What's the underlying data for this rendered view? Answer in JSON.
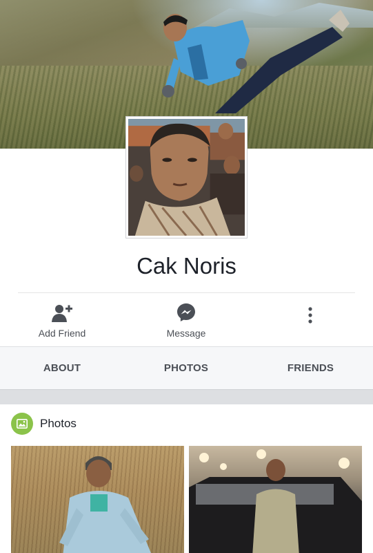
{
  "profile": {
    "name": "Cak Noris"
  },
  "actions": [
    {
      "label": "Add Friend",
      "icon": "add-friend-icon"
    },
    {
      "label": "Message",
      "icon": "messenger-icon"
    },
    {
      "label": "",
      "icon": "more-options-icon"
    }
  ],
  "tabs": [
    {
      "label": "ABOUT"
    },
    {
      "label": "PHOTOS"
    },
    {
      "label": "FRIENDS"
    }
  ],
  "photos_section": {
    "title": "Photos",
    "icon": "photos-icon",
    "accent_color": "#8bc34a"
  }
}
